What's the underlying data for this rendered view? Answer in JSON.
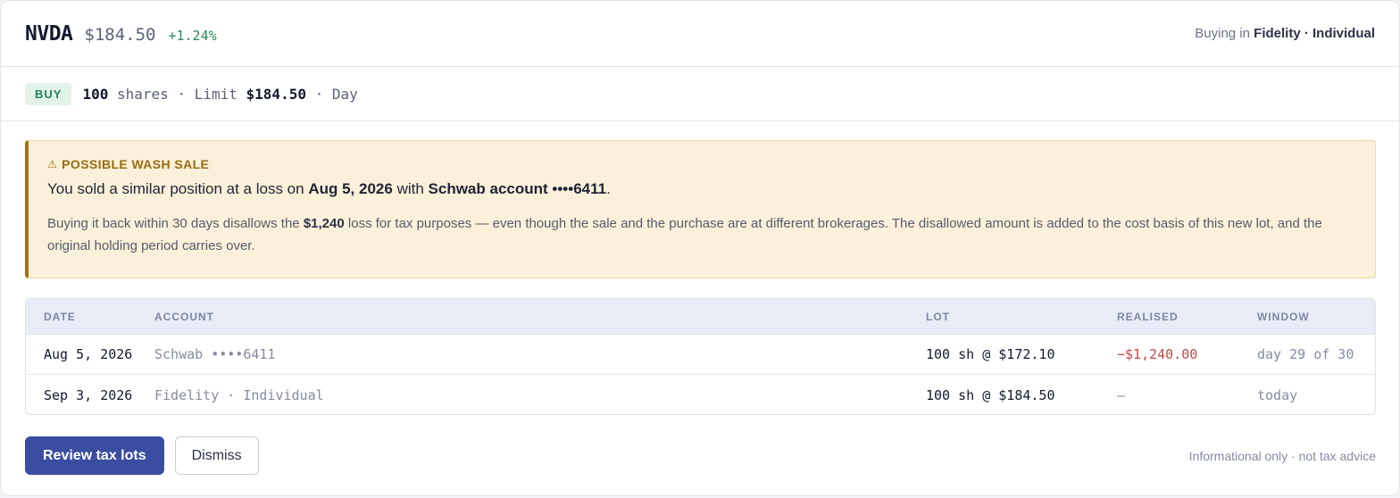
{
  "header": {
    "ticker": "NVDA",
    "price": "$184.50",
    "change": "+1.24%",
    "buying_prefix": "Buying in",
    "buying_account": "Fidelity · Individual"
  },
  "order": {
    "side": "BUY",
    "qty": "100",
    "qty_unit": "shares",
    "sep1": "·",
    "limit_label": "Limit",
    "limit_price": "$184.50",
    "sep2": "·",
    "duration": "Day"
  },
  "warning": {
    "icon": "warning-triangle-icon",
    "title": "POSSIBLE WASH SALE",
    "main_prefix": "You sold a similar position at a loss on",
    "main_date": "Aug 5, 2026",
    "main_mid": "with",
    "main_account": "Schwab account ••••6411",
    "main_suffix": ".",
    "detail_prefix": "Buying it back within 30 days disallows the",
    "detail_amount": "$1,240",
    "detail_suffix": "loss for tax purposes — even though the sale and the purchase are at different brokerages. The disallowed amount is added to the cost basis of this new lot, and the original holding period carries over."
  },
  "table": {
    "headers": [
      "DATE",
      "ACCOUNT",
      "LOT",
      "REALISED",
      "WINDOW"
    ],
    "rows": [
      {
        "date": "Aug 5, 2026",
        "account": "Schwab ••••6411",
        "lot": "100 sh @ $172.10",
        "realised": "−$1,240.00",
        "window": "day 29 of 30"
      },
      {
        "date": "Sep 3, 2026",
        "account": "Fidelity · Individual",
        "lot": "100 sh @ $184.50",
        "realised": "—",
        "window": "today"
      }
    ]
  },
  "footer": {
    "review_label": "Review tax lots",
    "dismiss_label": "Dismiss",
    "disclaimer": "Informational only · not tax advice"
  },
  "colors": {
    "positive": "#2e8a5c",
    "negative": "#c64848",
    "primary": "#3a4da0",
    "warning_accent": "#a57417",
    "warning_bg": "#fbf0d9"
  }
}
